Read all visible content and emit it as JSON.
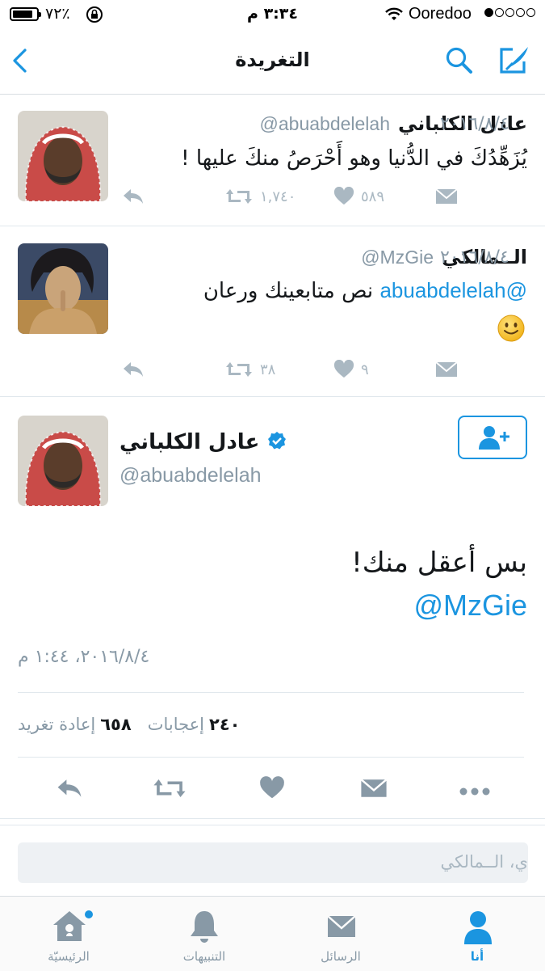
{
  "status_bar": {
    "battery": "٧٢٪",
    "time": "٣:٣٤ م",
    "carrier": "Ooredoo"
  },
  "nav": {
    "title": "التغريدة"
  },
  "tweets": [
    {
      "name": "عادل الكلباني",
      "handle": "@abuabdelelah",
      "date": "٢٠١٦/٨/٤",
      "text": "يُزَهِّدُكَ في الدُّنيا وهو أَحْرَصُ منكَ عليها !",
      "retweets": "١,٧٤٠",
      "likes": "٥٨٩"
    },
    {
      "name": "الــمالكي",
      "handle": "@MzGie",
      "date": "٢٠١٦/٨/٤",
      "mention": "@abuabdelelah",
      "text": "نص متابعينك ورعان",
      "emoji": "🙂",
      "retweets": "٣٨",
      "likes": "٩"
    }
  ],
  "main_tweet": {
    "name": "عادل الكلباني",
    "handle": "@abuabdelelah",
    "text": "بس أعقل منك!",
    "mention": "@MzGie",
    "timestamp": "٢٠١٦/٨/٤، ١:٤٤ م",
    "likes_count": "٢٤٠",
    "likes_label": "إعجابات",
    "retweets_count": "٦٥٨",
    "retweets_label": "إعادة تغريد"
  },
  "reply": {
    "placeholder": "ي، الــمالكي"
  },
  "tabs": [
    {
      "label": "الرئيسيّة"
    },
    {
      "label": "التنبيهات"
    },
    {
      "label": "الرسائل"
    },
    {
      "label": "أنا"
    }
  ],
  "colors": {
    "accent": "#1b95e0",
    "muted": "#aab8c2",
    "text": "#14171a"
  }
}
